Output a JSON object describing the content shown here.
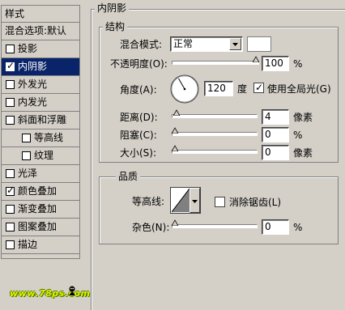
{
  "sidebar": {
    "header": "样式",
    "items": [
      {
        "label": "混合选项:默认",
        "checkbox": false,
        "checked": false,
        "indent": 0,
        "selected": false
      },
      {
        "label": "投影",
        "checkbox": true,
        "checked": false,
        "indent": 0,
        "selected": false
      },
      {
        "label": "内阴影",
        "checkbox": true,
        "checked": true,
        "indent": 0,
        "selected": true
      },
      {
        "label": "外发光",
        "checkbox": true,
        "checked": false,
        "indent": 0,
        "selected": false
      },
      {
        "label": "内发光",
        "checkbox": true,
        "checked": false,
        "indent": 0,
        "selected": false
      },
      {
        "label": "斜面和浮雕",
        "checkbox": true,
        "checked": false,
        "indent": 0,
        "selected": false
      },
      {
        "label": "等高线",
        "checkbox": true,
        "checked": false,
        "indent": 1,
        "selected": false
      },
      {
        "label": "纹理",
        "checkbox": true,
        "checked": false,
        "indent": 1,
        "selected": false
      },
      {
        "label": "光泽",
        "checkbox": true,
        "checked": false,
        "indent": 0,
        "selected": false
      },
      {
        "label": "颜色叠加",
        "checkbox": true,
        "checked": true,
        "indent": 0,
        "selected": false
      },
      {
        "label": "渐变叠加",
        "checkbox": true,
        "checked": false,
        "indent": 0,
        "selected": false
      },
      {
        "label": "图案叠加",
        "checkbox": true,
        "checked": false,
        "indent": 0,
        "selected": false
      },
      {
        "label": "描边",
        "checkbox": true,
        "checked": false,
        "indent": 0,
        "selected": false
      }
    ],
    "watermark": "www.78ps.com"
  },
  "panel": {
    "title": "内阴影",
    "structure": {
      "legend": "结构",
      "blend_mode_label": "混合模式:",
      "blend_mode_value": "正常",
      "shadow_color": "#ffffff",
      "opacity_label": "不透明度(O):",
      "opacity_value": "100",
      "opacity_unit": "%",
      "opacity_level": 1.0,
      "angle_label": "角度(A):",
      "angle_value": "120",
      "angle_unit": "度",
      "global_light_label": "使用全局光(G)",
      "global_light_checked": true,
      "distance_label": "距离(D):",
      "distance_value": "4",
      "distance_unit": "像素",
      "choke_label": "阻塞(C):",
      "choke_value": "0",
      "choke_unit": "%",
      "size_label": "大小(S):",
      "size_value": "0",
      "size_unit": "像素"
    },
    "quality": {
      "legend": "品质",
      "contour_label": "等高线:",
      "antialias_label": "消除锯齿(L)",
      "antialias_checked": false,
      "noise_label": "杂色(N):",
      "noise_value": "0",
      "noise_unit": "%"
    }
  },
  "colors": {
    "selection": "#0a246a",
    "face": "#d4d0c8"
  },
  "icons": [
    "checkmark-icon",
    "dropdown-arrow-icon",
    "slider-knob-icon",
    "angle-dial-icon",
    "contour-preview-icon",
    "watermark-mascot-icon"
  ]
}
